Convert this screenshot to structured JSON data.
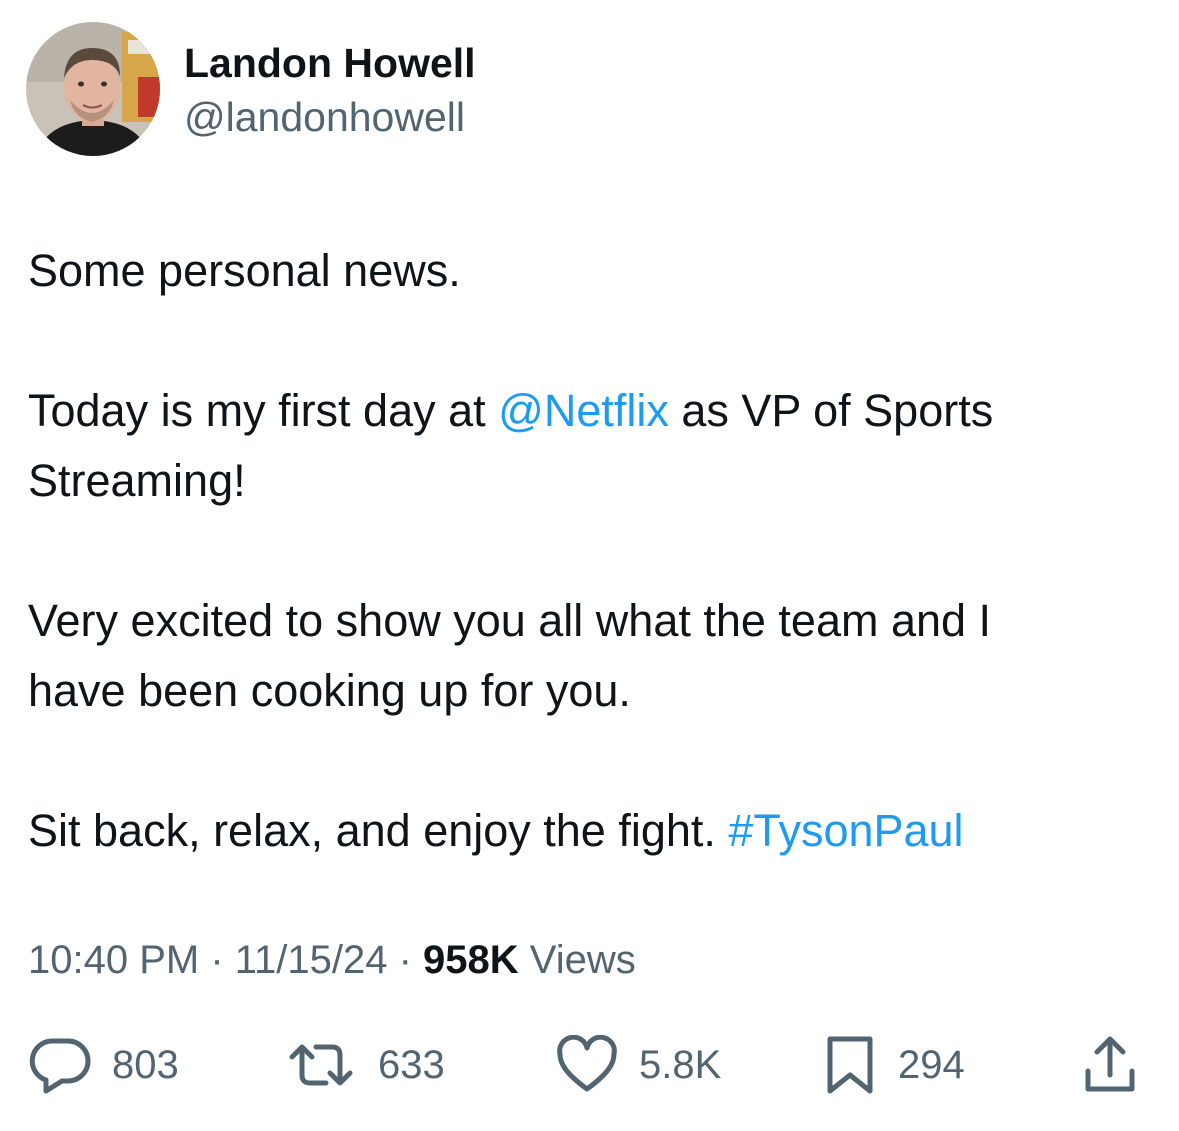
{
  "author": {
    "display_name": "Landon Howell",
    "handle": "@landonhowell",
    "avatar_icon": "profile-photo"
  },
  "tweet": {
    "p1": "Some personal news.",
    "p2_before": "Today is my first day at ",
    "p2_mention": "@Netflix",
    "p2_after": " as VP of Sports",
    "p2_line2": "Streaming!",
    "p3_line1": "Very excited to show you all what the team and I",
    "p3_line2": "have been cooking up for you.",
    "p4_before": "Sit back, relax, and enjoy the fight. ",
    "p4_hashtag": "#TysonPaul"
  },
  "meta": {
    "time": "10:40 PM",
    "separator": " · ",
    "date": "11/15/24",
    "views_count": "958K",
    "views_label": " Views"
  },
  "actions": {
    "replies": {
      "count": "803",
      "icon": "reply-icon"
    },
    "reposts": {
      "count": "633",
      "icon": "repost-icon"
    },
    "likes": {
      "count": "5.8K",
      "icon": "heart-icon"
    },
    "bookmarks": {
      "count": "294",
      "icon": "bookmark-icon"
    },
    "share": {
      "icon": "share-icon"
    }
  },
  "colors": {
    "text": "#0f1419",
    "secondary": "#536471",
    "link": "#1d9bf0",
    "background": "#ffffff"
  }
}
